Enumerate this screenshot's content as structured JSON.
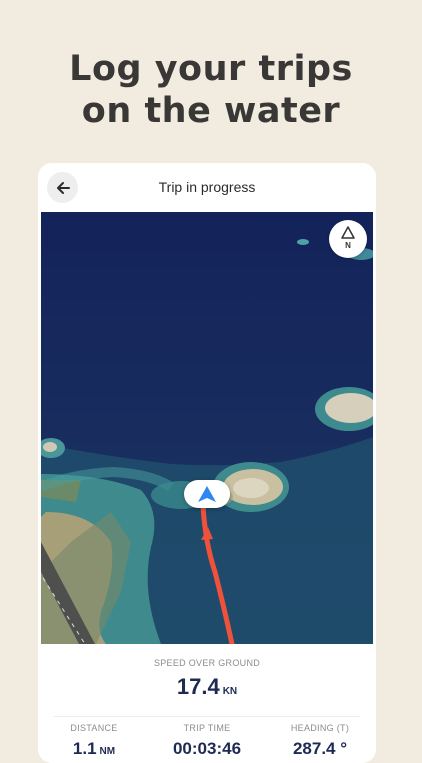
{
  "headline": {
    "line1": "Log your trips",
    "line2": "on the water"
  },
  "topbar": {
    "title": "Trip in progress"
  },
  "map": {
    "compass_label": "N"
  },
  "stats": {
    "speed_label": "SPEED OVER GROUND",
    "speed_value": "17.4",
    "speed_unit": "KN",
    "distance_label": "DISTANCE",
    "distance_value": "1.1",
    "distance_unit": "NM",
    "trip_time_label": "TRIP TIME",
    "trip_time_value": "00:03:46",
    "heading_label": "HEADING (T)",
    "heading_value": "287.4 °"
  },
  "colors": {
    "background": "#f2ece0",
    "headline": "#3a3836",
    "ocean": "#16265a",
    "track": "#f0513a",
    "vessel_arrow": "#2f86f0",
    "value_text": "#1e2a52"
  },
  "icons": {
    "back": "arrow-left-icon",
    "compass": "north-compass-icon",
    "vessel": "navigation-arrow-icon"
  }
}
